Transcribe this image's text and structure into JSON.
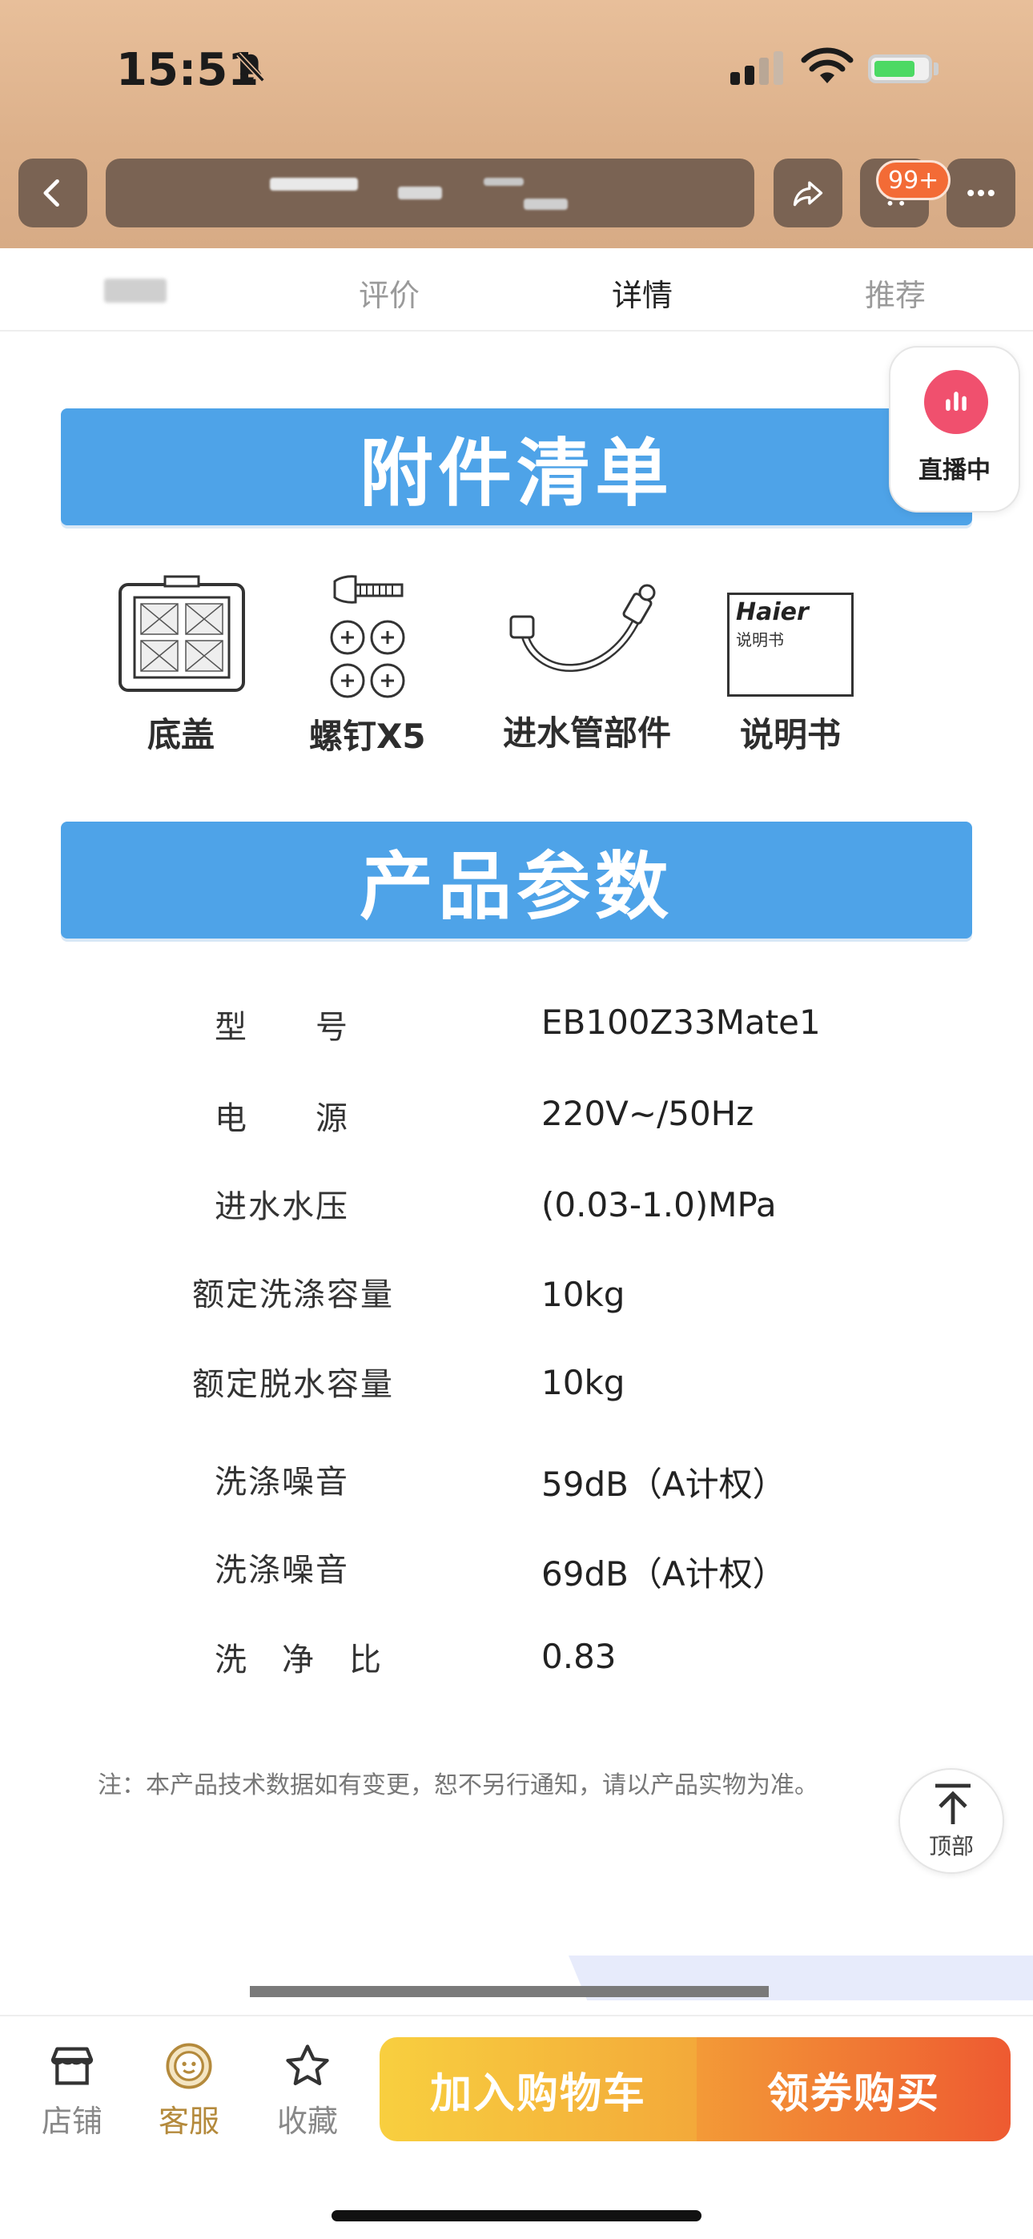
{
  "status_bar": {
    "time": "15:51"
  },
  "header": {
    "cart_badge": "99+"
  },
  "tabs": [
    {
      "label": "评价"
    },
    {
      "label": "详情"
    },
    {
      "label": "推荐"
    }
  ],
  "live": {
    "label": "直播中"
  },
  "accessories": {
    "title": "附件清单",
    "items": [
      {
        "label": "底盖"
      },
      {
        "label": "螺钉X5"
      },
      {
        "label": "进水管部件"
      },
      {
        "label": "说明书"
      }
    ],
    "manual_brand": "Haier",
    "manual_text": "说明书"
  },
  "params": {
    "title": "产品参数",
    "rows": [
      {
        "label": "型　　号",
        "value": "EB100Z33Mate1"
      },
      {
        "label": "电　　源",
        "value": "220V~/50Hz"
      },
      {
        "label": "进水水压",
        "value": "(0.03-1.0)MPa"
      },
      {
        "label": "额定洗涤容量",
        "value": "10kg"
      },
      {
        "label": "额定脱水容量",
        "value": "10kg"
      },
      {
        "label": "洗涤噪音",
        "value": "59dB（A计权）"
      },
      {
        "label": "洗涤噪音",
        "value": "69dB（A计权）"
      },
      {
        "label": "洗　净　比",
        "value": "0.83"
      }
    ],
    "note": "注：本产品技术数据如有变更，恕不另行通知，请以产品实物为准。"
  },
  "back_to_top": {
    "label": "顶部"
  },
  "bottom_bar": {
    "store": "店铺",
    "service": "客服",
    "favorite": "收藏",
    "add_to_cart": "加入购物车",
    "buy": "领券购买"
  }
}
